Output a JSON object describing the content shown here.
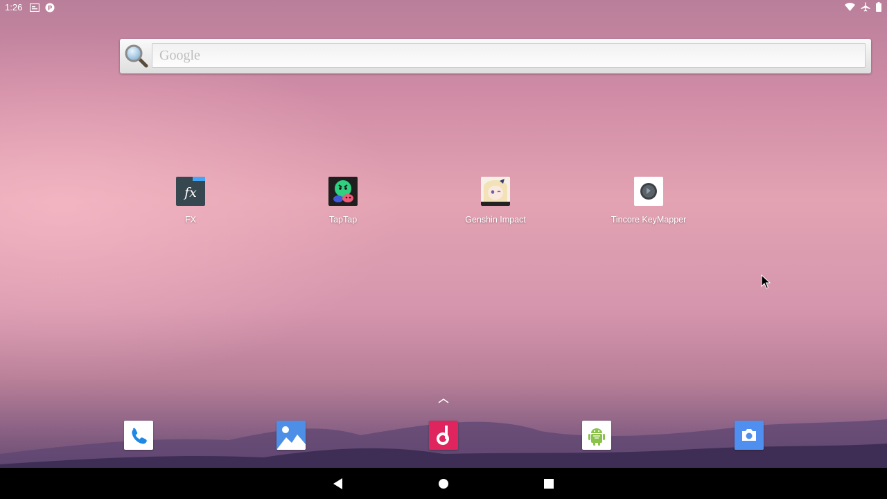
{
  "status_bar": {
    "time": "1:26",
    "left_icons": [
      "notification-card-icon",
      "p-circle-icon"
    ],
    "right_icons": [
      "wifi-icon",
      "airplane-mode-icon",
      "battery-icon"
    ]
  },
  "search": {
    "placeholder": "Google",
    "icon": "magnifier-icon"
  },
  "apps": [
    {
      "label": "FX",
      "icon": "fx-file-manager-icon"
    },
    {
      "label": "TapTap",
      "icon": "taptap-icon"
    },
    {
      "label": "Genshin Impact",
      "icon": "genshin-impact-icon"
    },
    {
      "label": "Tincore KeyMapper",
      "icon": "tincore-keymapper-icon"
    }
  ],
  "dock": [
    "phone-icon",
    "gallery-icon",
    "music-icon",
    "android-app-icon",
    "camera-icon"
  ],
  "nav": [
    "back-icon",
    "home-icon",
    "recents-icon"
  ],
  "colors": {
    "nav_bar": "#000000",
    "fx_bg": "#37474f",
    "taptap_bg": "#1f1f1f",
    "music_bg": "#e0245e",
    "camera_bg": "#4f8ff0"
  }
}
